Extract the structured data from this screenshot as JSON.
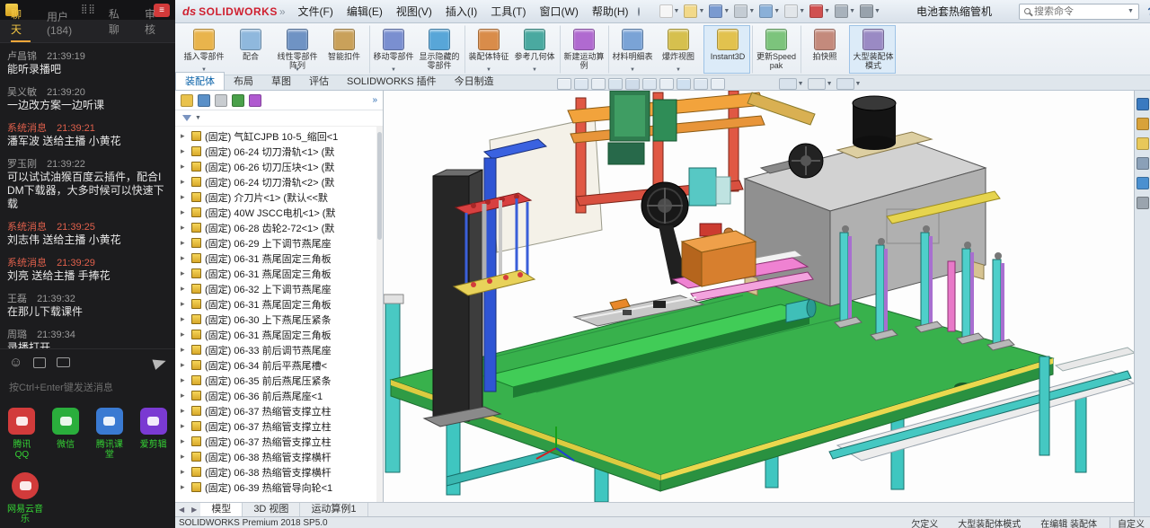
{
  "chat": {
    "tabs": [
      {
        "label": "聊天",
        "active": true
      },
      {
        "label": "用户 (184)",
        "active": false
      },
      {
        "label": "私聊",
        "active": false
      },
      {
        "label": "审核",
        "active": false
      }
    ],
    "messages": [
      {
        "user": "卢昌锦",
        "time": "21:39:19",
        "text": "能听录播吧",
        "system": false
      },
      {
        "user": "吴义敏",
        "time": "21:39:20",
        "text": "一边改方案一边听课",
        "system": false
      },
      {
        "user": "系统消息",
        "time": "21:39:21",
        "text": "潘军波 送给主播 小黄花",
        "system": true
      },
      {
        "user": "罗玉刚",
        "time": "21:39:22",
        "text": "可以试试油猴百度云插件，配合IDM下载器，大多时候可以快速下载",
        "system": false
      },
      {
        "user": "系统消息",
        "time": "21:39:25",
        "text": "刘志伟 送给主播 小黄花",
        "system": true
      },
      {
        "user": "系统消息",
        "time": "21:39:29",
        "text": "刘亮 送给主播 手捧花",
        "system": true
      },
      {
        "user": "王磊",
        "time": "21:39:32",
        "text": "在那儿下载课件",
        "system": false
      },
      {
        "user": "周璐",
        "time": "21:39:34",
        "text": "录播打开",
        "system": false
      }
    ],
    "input_hint": "按Ctrl+Enter键发送消息",
    "red_button_glyph": "≡",
    "grid_glyph": "⣿⣿"
  },
  "desktop": {
    "row1": [
      {
        "label": "腾讯QQ",
        "color": "#d23b3b"
      },
      {
        "label": "微信",
        "color": "#2aae3c"
      },
      {
        "label": "腾讯课堂",
        "color": "#3a7ad2"
      },
      {
        "label": "爱剪辑",
        "color": "#7a3ad2"
      }
    ],
    "row2": [
      {
        "label": "网易云音乐",
        "color": "#d23b3b"
      }
    ]
  },
  "sw": {
    "logo_ds": "ds",
    "logo_name": "SOLIDWORKS",
    "logo_caret": "»",
    "menus": [
      "文件(F)",
      "编辑(E)",
      "视图(V)",
      "插入(I)",
      "工具(T)",
      "窗口(W)",
      "帮助(H)"
    ],
    "quick_icons": [
      {
        "name": "new-file-icon",
        "color": "#f6f6f6",
        "dropdown": true
      },
      {
        "name": "open-file-icon",
        "color": "#f2d98a",
        "dropdown": false
      },
      {
        "name": "save-icon",
        "color": "#7a9ad0",
        "dropdown": true
      },
      {
        "name": "print-icon",
        "color": "#c4ccd4",
        "dropdown": true
      },
      {
        "name": "undo-icon",
        "color": "#8ab0d8",
        "dropdown": true
      },
      {
        "name": "select-icon",
        "color": "#e2e6ea",
        "dropdown": true
      },
      {
        "name": "rebuild-icon",
        "color": "#d05050",
        "dropdown": false
      },
      {
        "name": "file-properties-icon",
        "color": "#a8b2bc",
        "dropdown": false
      },
      {
        "name": "options-gear-icon",
        "color": "#98a2ac",
        "dropdown": true
      }
    ],
    "doc_title": "电池套热缩管机",
    "search": {
      "placeholder": "搜索命令"
    },
    "window_buttons": {
      "help": "?",
      "min": "—",
      "max": "□",
      "close": "×"
    },
    "ribbon": {
      "buttons": [
        {
          "label": "插入零部件",
          "color": "#e9b44c",
          "dropdown": true,
          "sep_before": false,
          "active": false
        },
        {
          "label": "配合",
          "color": "#8fb8dd",
          "dropdown": false,
          "sep_before": false,
          "active": false
        },
        {
          "label": "线性零部件阵列",
          "color": "#6f93c4",
          "dropdown": true,
          "sep_before": false,
          "active": false
        },
        {
          "label": "智能扣件",
          "color": "#c9a15a",
          "dropdown": false,
          "sep_before": false,
          "active": false
        },
        {
          "label": "移动零部件",
          "color": "#7a8fd0",
          "dropdown": true,
          "sep_before": true,
          "active": false
        },
        {
          "label": "显示隐藏的零部件",
          "color": "#58a6d8",
          "dropdown": false,
          "sep_before": false,
          "active": false
        },
        {
          "label": "装配体特征",
          "color": "#d98c4a",
          "dropdown": true,
          "sep_before": true,
          "active": false
        },
        {
          "label": "参考几何体",
          "color": "#4aa9a0",
          "dropdown": true,
          "sep_before": false,
          "active": false
        },
        {
          "label": "新建运动算例",
          "color": "#b06ad0",
          "dropdown": false,
          "sep_before": true,
          "active": false
        },
        {
          "label": "材料明细表",
          "color": "#7aa3d6",
          "dropdown": true,
          "sep_before": true,
          "active": false
        },
        {
          "label": "爆炸视图",
          "color": "#d6c04e",
          "dropdown": true,
          "sep_before": false,
          "active": false
        },
        {
          "label": "Instant3D",
          "color": "#e2c24e",
          "dropdown": false,
          "sep_before": true,
          "active": true
        },
        {
          "label": "更新Speedpak",
          "color": "#7cc47c",
          "dropdown": false,
          "sep_before": true,
          "active": false
        },
        {
          "label": "拍快照",
          "color": "#c48a7c",
          "dropdown": false,
          "sep_before": true,
          "active": false
        },
        {
          "label": "大型装配体模式",
          "color": "#9a8ac4",
          "dropdown": false,
          "sep_before": true,
          "active": true
        }
      ]
    },
    "tabs": [
      {
        "label": "装配体",
        "active": true
      },
      {
        "label": "布局",
        "active": false
      },
      {
        "label": "草图",
        "active": false
      },
      {
        "label": "评估",
        "active": false
      },
      {
        "label": "SOLIDWORKS 插件",
        "active": false
      },
      {
        "label": "今日制造",
        "active": false
      }
    ],
    "headsup_icons": [
      {
        "name": "zoom-fit-icon",
        "color": "#e8eef4"
      },
      {
        "name": "zoom-area-icon",
        "color": "#dce6f0"
      },
      {
        "name": "previous-view-icon",
        "color": "#e8eef4"
      },
      {
        "name": "section-view-icon",
        "color": "#d8e4ee"
      },
      {
        "name": "view-orientation-icon",
        "color": "#cfdcea"
      },
      {
        "name": "display-style-icon",
        "color": "#dce6f0"
      },
      {
        "name": "hide-show-items-icon",
        "color": "#e8eef4"
      },
      {
        "name": "edit-appearance-icon",
        "color": "#cfe0f0"
      },
      {
        "name": "apply-scene-icon",
        "color": "#dce6f0"
      },
      {
        "name": "view-settings-icon",
        "color": "#e8eef4"
      }
    ],
    "headsup2_icons": [
      {
        "name": "display-pane-icon",
        "color": "#d8e2ec"
      },
      {
        "name": "screen-capture-icon",
        "color": "#cddaе6"
      },
      {
        "name": "display-states-icon",
        "color": "#d8e2ec"
      }
    ],
    "tree": {
      "toolbar_icons": [
        {
          "name": "feature-manager-icon",
          "color": "#e9c24c"
        },
        {
          "name": "property-manager-icon",
          "color": "#5a90c8"
        },
        {
          "name": "configuration-manager-icon",
          "color": "#c8ccd0"
        },
        {
          "name": "dimxpert-manager-icon",
          "color": "#4aa04a"
        },
        {
          "name": "display-manager-icon",
          "color": "#b05ad0"
        }
      ],
      "flyout_glyph": "»",
      "items": [
        "(固定) 气缸CJPB 10-5_缩回<1",
        "(固定) 06-24 切刀滑轨<1> (默",
        "(固定) 06-26 切刀压块<1> (默",
        "(固定) 06-24 切刀滑轨<2> (默",
        "(固定) 介刀片<1> (默认<<默",
        "(固定) 40W JSCC电机<1> (默",
        "(固定) 06-28 齿轮2-72<1> (默",
        "(固定) 06-29 上下调节燕尾座",
        "(固定) 06-31 燕尾固定三角板",
        "(固定) 06-31 燕尾固定三角板",
        "(固定) 06-32 上下调节燕尾座",
        "(固定) 06-31 燕尾固定三角板",
        "(固定) 06-30 上下燕尾压紧条",
        "(固定) 06-31 燕尾固定三角板",
        "(固定) 06-33 前后调节燕尾座",
        "(固定) 06-34 前后平燕尾槽<",
        "(固定) 06-35 前后燕尾压紧条",
        "(固定) 06-36 前后燕尾座<1",
        "(固定) 06-37 热缩管支撑立柱",
        "(固定) 06-37 热缩管支撑立柱",
        "(固定) 06-37 热缩管支撑立柱",
        "(固定) 06-38 热缩管支撑横杆",
        "(固定) 06-38 热缩管支撑横杆",
        "(固定) 06-39 热缩管导向轮<1"
      ]
    },
    "taskpane_icons": [
      {
        "name": "resources-home-icon",
        "color": "#3a7ac0"
      },
      {
        "name": "design-library-icon",
        "color": "#d8a23a"
      },
      {
        "name": "file-explorer-icon",
        "color": "#e8c85a"
      },
      {
        "name": "view-palette-icon",
        "color": "#8aa0b8"
      },
      {
        "name": "appearances-icon",
        "color": "#4a90d0"
      },
      {
        "name": "custom-properties-icon",
        "color": "#9aa4ae"
      }
    ],
    "bottom_tabs": [
      {
        "label": "模型",
        "active": true
      },
      {
        "label": "3D 视图",
        "active": false
      },
      {
        "label": "运动算例1",
        "active": false
      }
    ],
    "status": {
      "left": "SOLIDWORKS Premium 2018 SP5.0",
      "right_items": [
        "欠定义",
        "大型装配体模式",
        "在编辑 装配体"
      ],
      "customize": "自定义"
    }
  }
}
